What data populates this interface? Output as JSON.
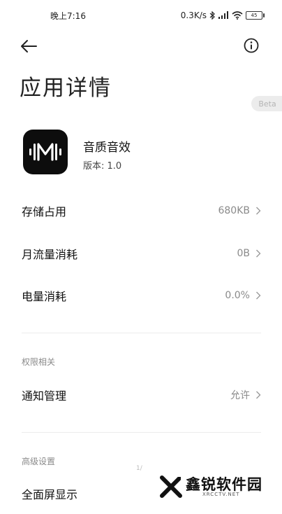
{
  "status_bar": {
    "time": "晚上7:16",
    "network_speed": "0.3K/s",
    "battery": "45"
  },
  "header": {
    "page_title": "应用详情",
    "beta_label": "Beta"
  },
  "app": {
    "name": "音质音效",
    "version": "版本: 1.0"
  },
  "rows": [
    {
      "label": "存储占用",
      "value": "680KB"
    },
    {
      "label": "月流量消耗",
      "value": "0B"
    },
    {
      "label": "电量消耗",
      "value": "0.0%"
    }
  ],
  "sections": [
    {
      "header": "权限相关",
      "rows": [
        {
          "label": "通知管理",
          "value": "允许"
        }
      ]
    },
    {
      "header": "高级设置",
      "rows": [
        {
          "label": "全面屏显示",
          "value": ""
        }
      ]
    }
  ],
  "scroll_hint": "1/",
  "watermark": {
    "text": "鑫锐软件园",
    "subtext": "XRCCTV.NET"
  }
}
